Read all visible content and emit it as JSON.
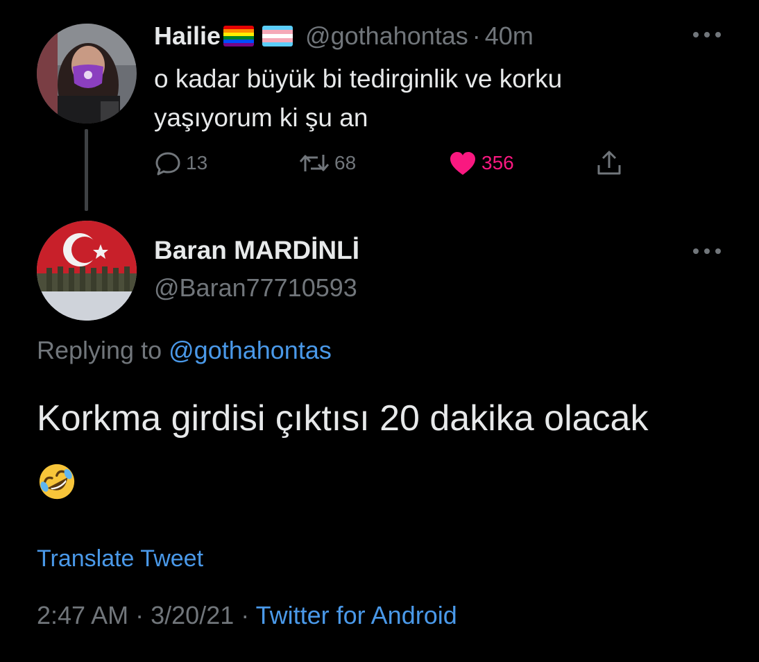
{
  "parent_tweet": {
    "display_name": "Hailie",
    "name_flags": [
      "rainbow-flag-icon",
      "transgender-flag-icon"
    ],
    "handle": "@gothahontas",
    "separator": "·",
    "time_ago": "40m",
    "text": "o kadar büyük bi tedirginlik ve korku yaşıyorum ki şu an",
    "reply_count": "13",
    "retweet_count": "68",
    "like_count": "356",
    "liked": true,
    "like_color": "#f91880"
  },
  "reply_tweet": {
    "display_name": "Baran MARDİNLİ",
    "handle": "@Baran77710593",
    "replying_label": "Replying to",
    "replying_handle": "@gothahontas",
    "text": "Korkma girdisi çıktısı 20 dakika olacak",
    "emoji": "rolling-on-the-floor-laughing-emoji",
    "translate_label": "Translate Tweet",
    "time": "2:47 AM",
    "date": "3/20/21",
    "separator": "·",
    "source": "Twitter for Android"
  },
  "colors": {
    "background": "#000000",
    "text": "#e7e9ea",
    "muted": "#71767b",
    "link": "#4a99e9"
  }
}
